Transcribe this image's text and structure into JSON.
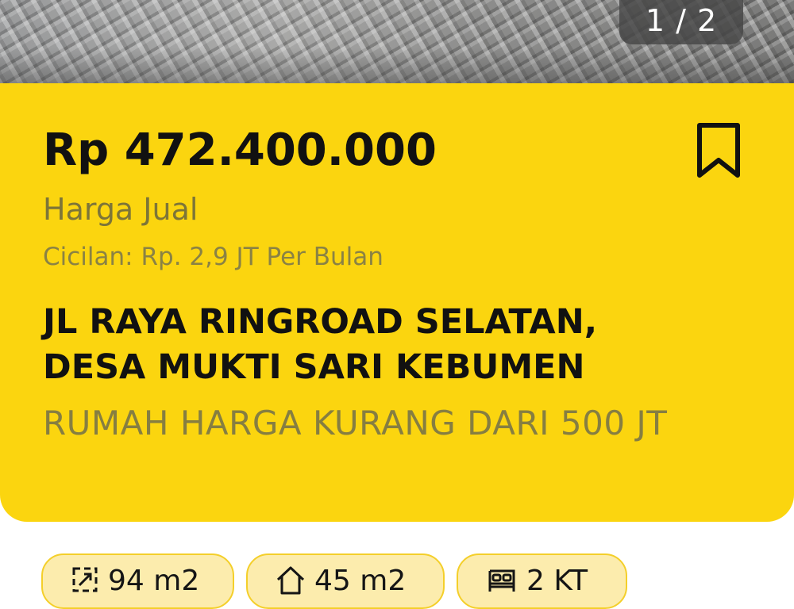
{
  "gallery": {
    "counter": "1 / 2"
  },
  "listing": {
    "price": "Rp 472.400.000",
    "price_label": "Harga Jual",
    "installment": "Cicilan: Rp. 2,9 JT Per Bulan",
    "address_line1": "JL RAYA RINGROAD SELATAN,",
    "address_line2": "DESA MUKTI SARI KEBUMEN",
    "category": "RUMAH HARGA KURANG DARI 500 JT",
    "bookmark_icon": "bookmark-icon"
  },
  "specs": [
    {
      "icon": "land-area-icon",
      "value": "94 m2"
    },
    {
      "icon": "house-icon",
      "value": "45 m2"
    },
    {
      "icon": "bed-icon",
      "value": "2 KT"
    }
  ],
  "colors": {
    "card": "#fbd50f",
    "chip": "#fcecad",
    "text": "#111111"
  }
}
